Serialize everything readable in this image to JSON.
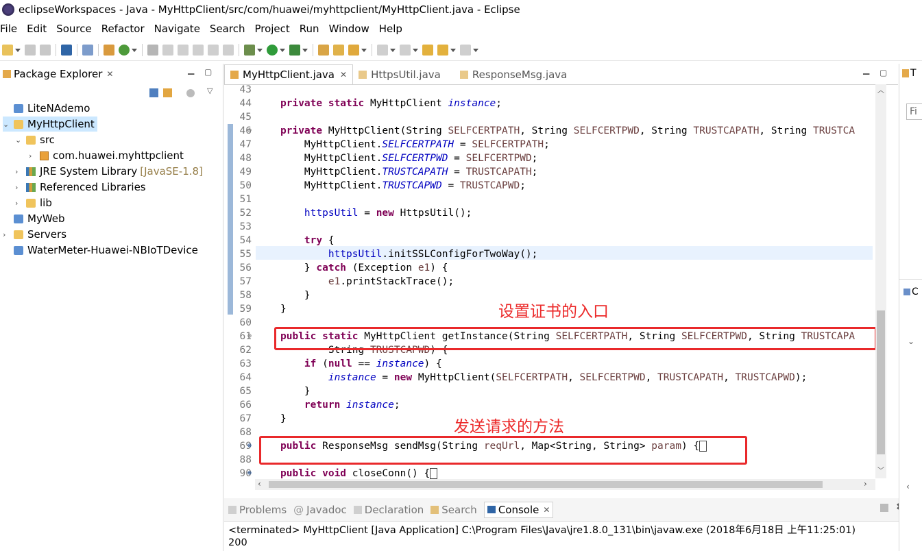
{
  "window": {
    "title": "eclipseWorkspaces - Java - MyHttpClient/src/com/huawei/myhttpclient/MyHttpClient.java - Eclipse"
  },
  "menu": [
    "File",
    "Edit",
    "Source",
    "Refactor",
    "Navigate",
    "Search",
    "Project",
    "Run",
    "Window",
    "Help"
  ],
  "package_explorer": {
    "title": "Package Explorer",
    "items": [
      {
        "label": "LiteNAdemo"
      },
      {
        "label": "MyHttpClient"
      },
      {
        "label": "src"
      },
      {
        "label": "com.huawei.myhttpclient"
      },
      {
        "label": "JRE System Library",
        "suffix": "[JavaSE-1.8]"
      },
      {
        "label": "Referenced Libraries"
      },
      {
        "label": "lib"
      },
      {
        "label": "MyWeb"
      },
      {
        "label": "Servers"
      },
      {
        "label": "WaterMeter-Huawei-NBIoTDevice"
      }
    ]
  },
  "editor": {
    "tabs": [
      "MyHttpClient.java",
      "HttpsUtil.java",
      "ResponseMsg.java"
    ],
    "line_numbers": [
      "43",
      "44",
      "45",
      "46",
      "47",
      "48",
      "49",
      "50",
      "51",
      "52",
      "53",
      "54",
      "55",
      "56",
      "57",
      "58",
      "59",
      "60",
      "61",
      "62",
      "63",
      "64",
      "65",
      "66",
      "67",
      "68",
      "69",
      "88",
      "90"
    ],
    "annotations": {
      "instance_entry": "设置证书的入口",
      "send_method": "发送请求的方法"
    }
  },
  "console": {
    "tabs": [
      "Problems",
      "Javadoc",
      "Declaration",
      "Search",
      "Console"
    ],
    "status": "<terminated> MyHttpClient [Java Application] C:\\Program Files\\Java\\jre1.8.0_131\\bin\\javaw.exe (2018年6月18日 上午11:25:01)",
    "output": "200"
  },
  "right_panel": {
    "tab_t": "T",
    "find_placeholder": "Fi",
    "tab_c": "C"
  },
  "colors": {
    "keyword": "#7f0055",
    "field": "#0000c0",
    "annotation_red": "#e9292b",
    "current_line": "#e8f2fe"
  }
}
